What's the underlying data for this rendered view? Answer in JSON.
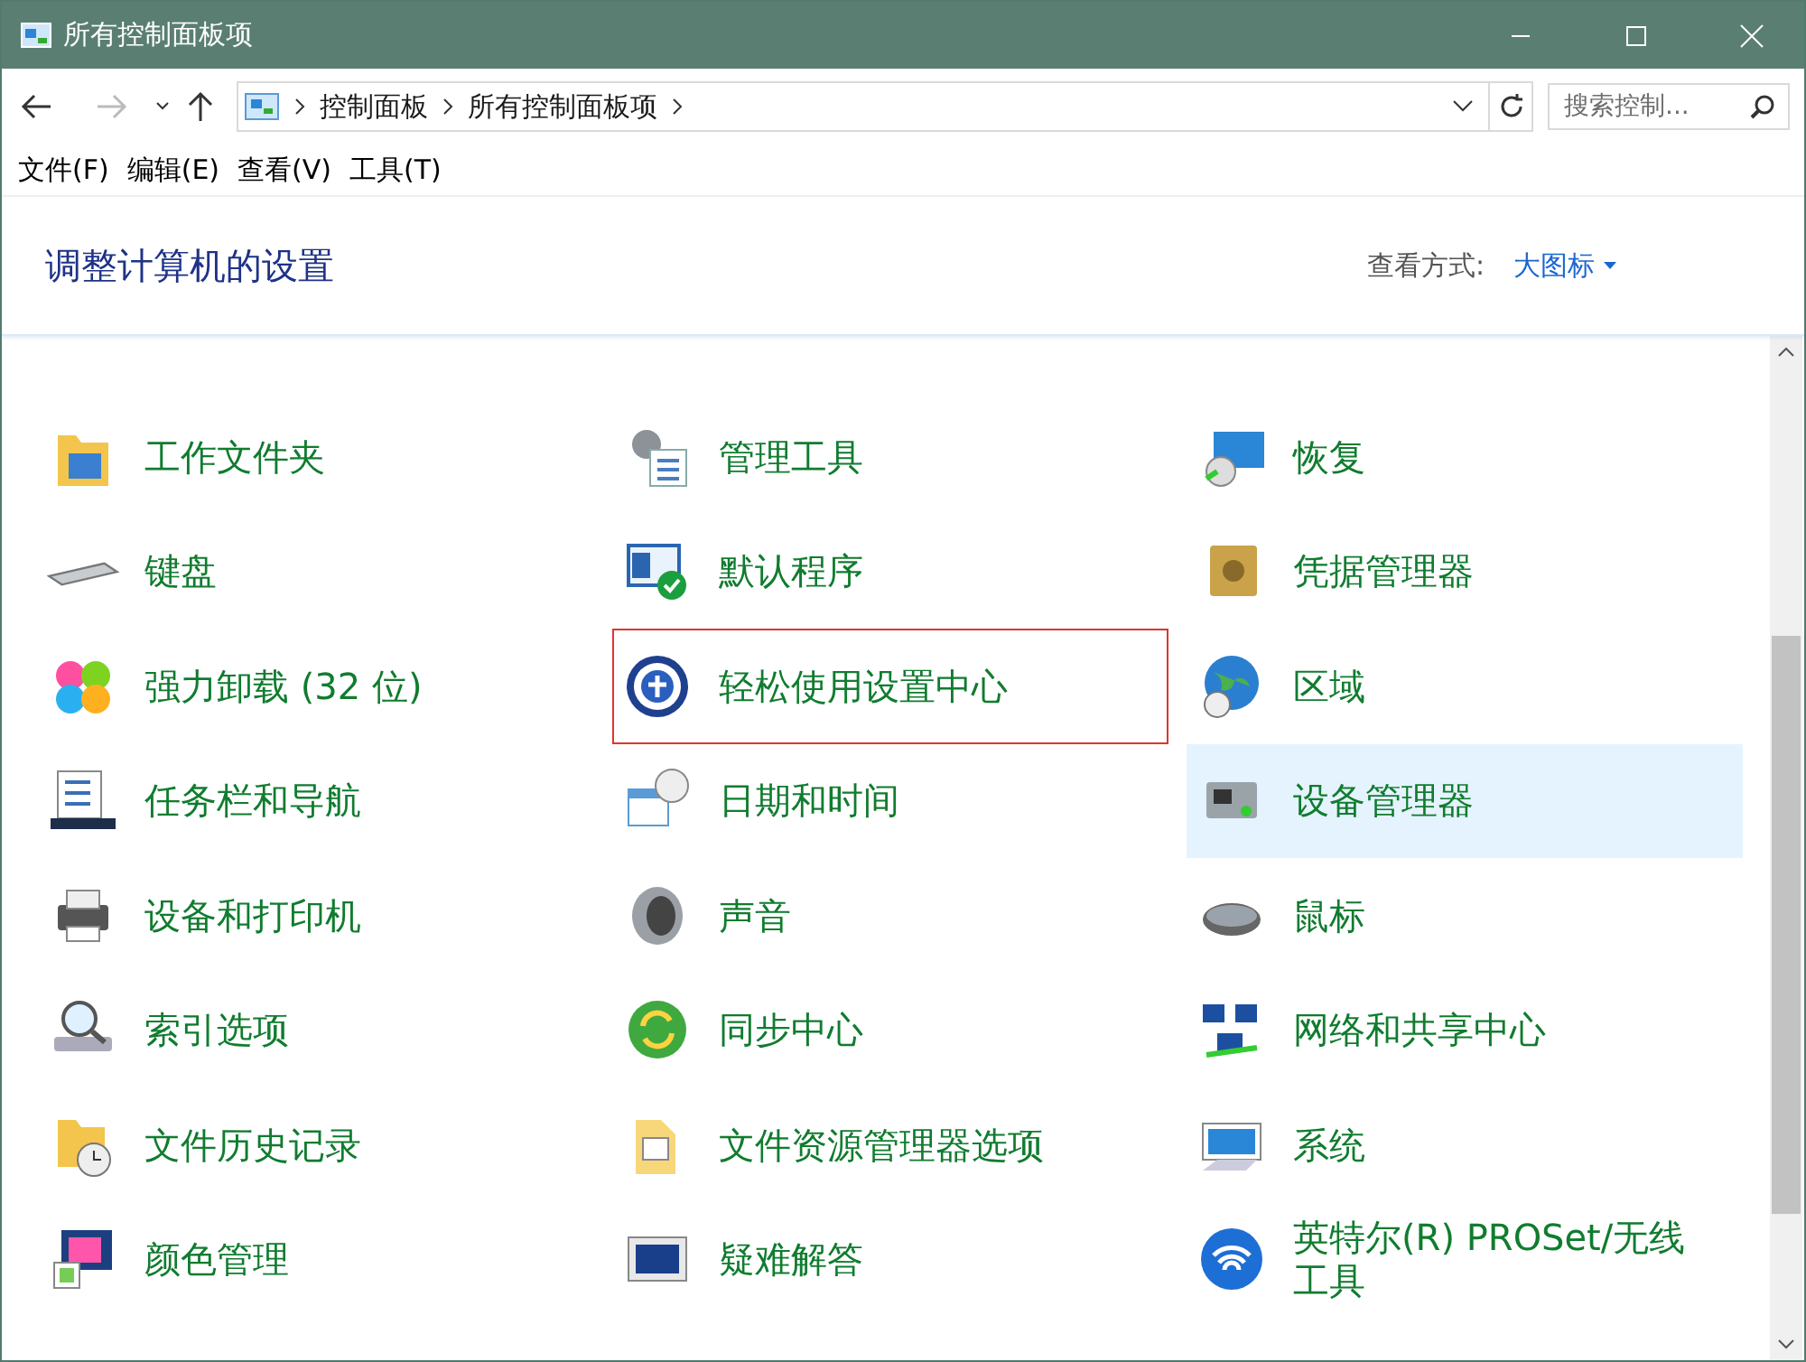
{
  "window": {
    "title": "所有控制面板项"
  },
  "address": {
    "segments": [
      "控制面板",
      "所有控制面板项"
    ]
  },
  "search": {
    "placeholder": "搜索控制..."
  },
  "menu": [
    "文件(F)",
    "编辑(E)",
    "查看(V)",
    "工具(T)"
  ],
  "header": {
    "title": "调整计算机的设置",
    "view_label": "查看方式:",
    "view_value": "大图标"
  },
  "items": [
    {
      "label": "工作文件夹",
      "selected": false,
      "annotated": false
    },
    {
      "label": "管理工具",
      "selected": false,
      "annotated": false
    },
    {
      "label": "恢复",
      "selected": false,
      "annotated": false
    },
    {
      "label": "键盘",
      "selected": false,
      "annotated": false
    },
    {
      "label": "默认程序",
      "selected": false,
      "annotated": false
    },
    {
      "label": "凭据管理器",
      "selected": false,
      "annotated": false
    },
    {
      "label": "强力卸载 (32 位)",
      "selected": false,
      "annotated": false
    },
    {
      "label": "轻松使用设置中心",
      "selected": false,
      "annotated": true
    },
    {
      "label": "区域",
      "selected": false,
      "annotated": false
    },
    {
      "label": "任务栏和导航",
      "selected": false,
      "annotated": false
    },
    {
      "label": "日期和时间",
      "selected": false,
      "annotated": false
    },
    {
      "label": "设备管理器",
      "selected": true,
      "annotated": false
    },
    {
      "label": "设备和打印机",
      "selected": false,
      "annotated": false
    },
    {
      "label": "声音",
      "selected": false,
      "annotated": false
    },
    {
      "label": "鼠标",
      "selected": false,
      "annotated": false
    },
    {
      "label": "索引选项",
      "selected": false,
      "annotated": false
    },
    {
      "label": "同步中心",
      "selected": false,
      "annotated": false
    },
    {
      "label": "网络和共享中心",
      "selected": false,
      "annotated": false
    },
    {
      "label": "文件历史记录",
      "selected": false,
      "annotated": false
    },
    {
      "label": "文件资源管理器选项",
      "selected": false,
      "annotated": false
    },
    {
      "label": "系统",
      "selected": false,
      "annotated": false
    },
    {
      "label": "颜色管理",
      "selected": false,
      "annotated": false
    },
    {
      "label": "疑难解答",
      "selected": false,
      "annotated": false
    },
    {
      "label": "英特尔(R) PROSet/无线工具",
      "selected": false,
      "annotated": false
    }
  ]
}
